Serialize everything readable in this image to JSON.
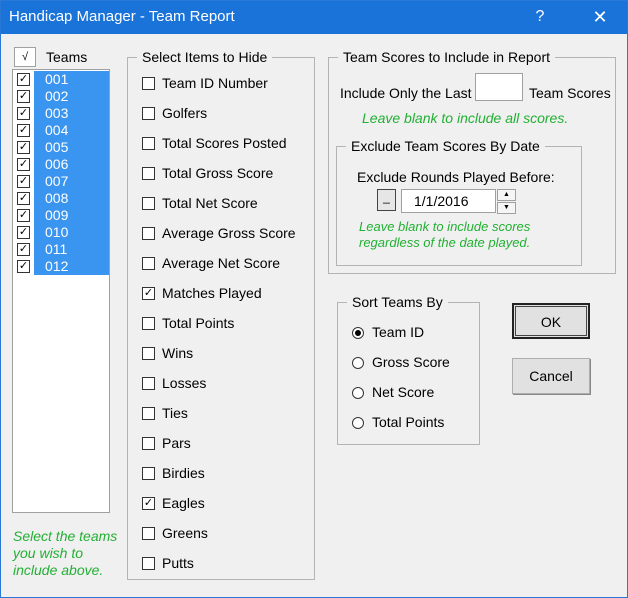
{
  "window": {
    "title": "Handicap Manager - Team Report",
    "help_glyph": "?",
    "close_glyph": "✕"
  },
  "teams": {
    "header_check": "√",
    "header_label": "Teams",
    "items": [
      "001",
      "002",
      "003",
      "004",
      "005",
      "006",
      "007",
      "008",
      "009",
      "010",
      "011",
      "012"
    ],
    "hint": "Select the teams you wish to include above."
  },
  "hide_items": {
    "legend": "Select Items to Hide",
    "items": [
      {
        "label": "Team ID Number",
        "checked": false
      },
      {
        "label": "Golfers",
        "checked": false
      },
      {
        "label": "Total Scores Posted",
        "checked": false
      },
      {
        "label": "Total Gross Score",
        "checked": false
      },
      {
        "label": "Total Net Score",
        "checked": false
      },
      {
        "label": "Average Gross Score",
        "checked": false
      },
      {
        "label": "Average Net Score",
        "checked": false
      },
      {
        "label": "Matches Played",
        "checked": true
      },
      {
        "label": "Total Points",
        "checked": false
      },
      {
        "label": "Wins",
        "checked": false
      },
      {
        "label": "Losses",
        "checked": false
      },
      {
        "label": "Ties",
        "checked": false
      },
      {
        "label": "Pars",
        "checked": false
      },
      {
        "label": "Birdies",
        "checked": false
      },
      {
        "label": "Eagles",
        "checked": true
      },
      {
        "label": "Greens",
        "checked": false
      },
      {
        "label": "Putts",
        "checked": false
      }
    ]
  },
  "team_scores": {
    "legend": "Team Scores to Include in Report",
    "include_last_label": "Include Only the Last",
    "include_last_value": "",
    "include_last_suffix": "Team Scores",
    "hint": "Leave blank to include all scores.",
    "exclude": {
      "legend": "Exclude Team Scores By Date",
      "label": "Exclude Rounds Played Before:",
      "date_button": "_",
      "date_value": "1/1/2016",
      "hint_line1": "Leave blank to include scores",
      "hint_line2": "regardless of the date played."
    }
  },
  "sort": {
    "legend": "Sort Teams By",
    "options": [
      {
        "label": "Team ID",
        "selected": true
      },
      {
        "label": "Gross Score",
        "selected": false
      },
      {
        "label": "Net Score",
        "selected": false
      },
      {
        "label": "Total Points",
        "selected": false
      }
    ]
  },
  "buttons": {
    "ok": "OK",
    "cancel": "Cancel"
  }
}
